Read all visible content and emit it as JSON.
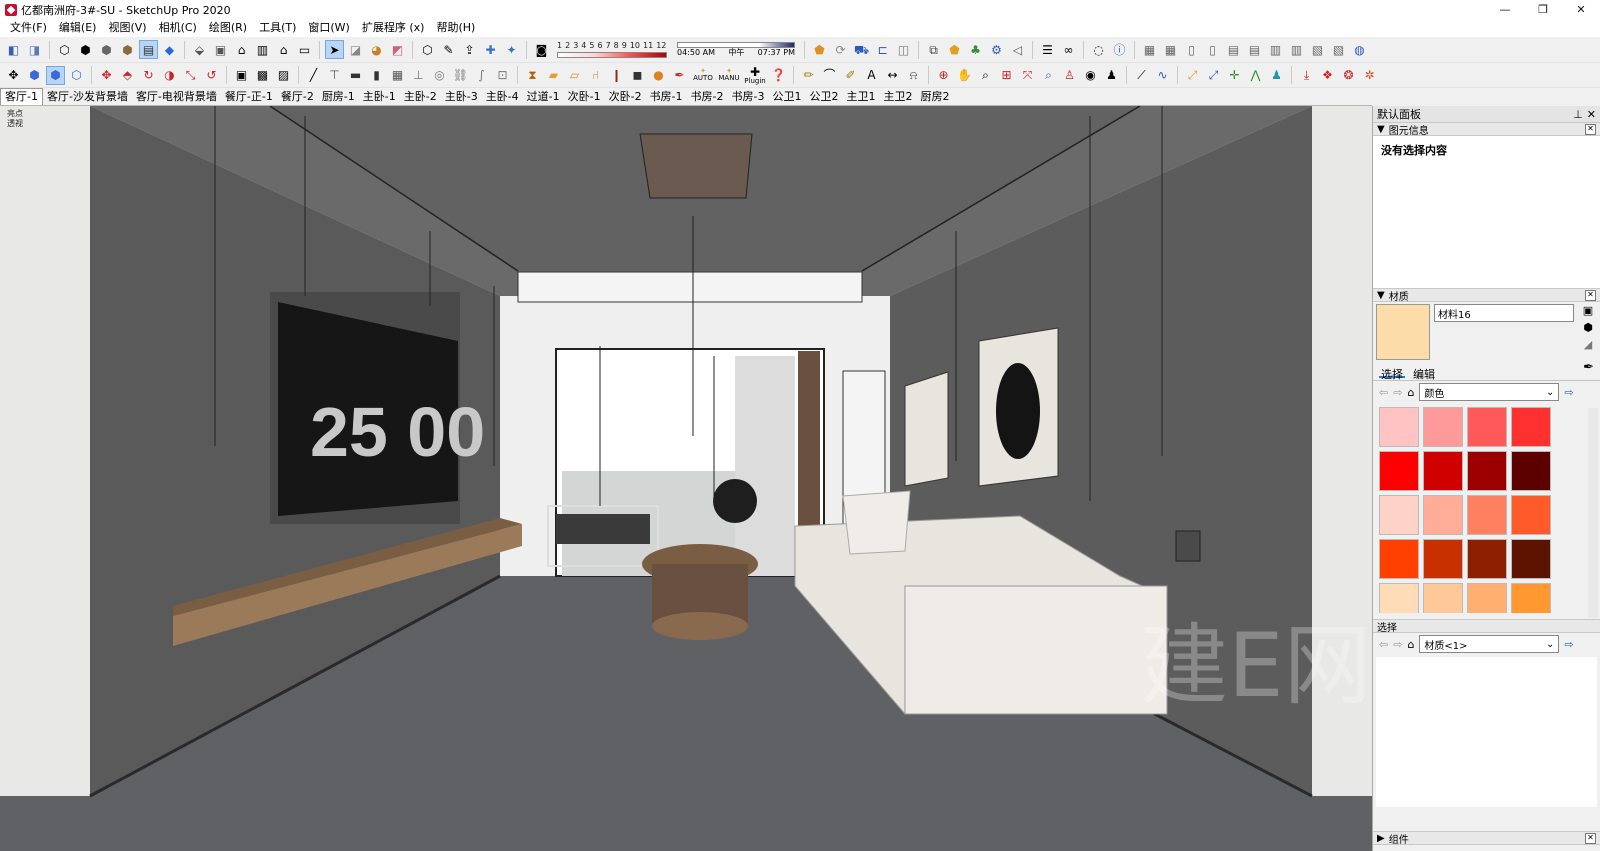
{
  "window": {
    "title": "亿都南洲府-3#-SU - SketchUp Pro 2020",
    "minimize": "—",
    "restore": "❐",
    "close": "✕"
  },
  "menu": [
    "文件(F)",
    "编辑(E)",
    "视图(V)",
    "相机(C)",
    "绘图(R)",
    "工具(T)",
    "窗口(W)",
    "扩展程序 (x)",
    "帮助(H)"
  ],
  "toolbar1": {
    "shadow_scale": [
      "1",
      "2",
      "3",
      "4",
      "5",
      "6",
      "7",
      "8",
      "9",
      "10",
      "11",
      "12"
    ],
    "time_start": "04:50 AM",
    "time_mid": "中午",
    "time_end": "07:37 PM"
  },
  "toolbar2": {
    "auto_label": "AUTO",
    "manu_label": "MANU",
    "plugin_label": "Plugin"
  },
  "scenes": [
    "客厅-1",
    "客厅-沙发背景墙",
    "客厅-电视背景墙",
    "餐厅-正-1",
    "餐厅-2",
    "厨房-1",
    "主卧-1",
    "主卧-2",
    "主卧-3",
    "主卧-4",
    "过道-1",
    "次卧-1",
    "次卧-2",
    "书房-1",
    "书房-2",
    "书房-3",
    "公卫1",
    "公卫2",
    "主卫1",
    "主卫2",
    "厨房2"
  ],
  "active_scene": "客厅-1",
  "viewport": {
    "label_line1": "亮点",
    "label_line2": "透视",
    "tv_text": "25 00"
  },
  "tray": {
    "title": "默认面板",
    "pin": "⊥",
    "close": "✕"
  },
  "entity_info": {
    "header": "图元信息",
    "empty": "没有选择内容"
  },
  "materials": {
    "header": "材质",
    "name": "材料16",
    "current_color": "#fcdca8",
    "tab_select": "选择",
    "tab_edit": "编辑",
    "collection": "颜色",
    "swatches": [
      "#ffc3c3",
      "#ff9a9a",
      "#ff5a5a",
      "#ff3030",
      "#ff0000",
      "#d00000",
      "#9c0000",
      "#5c0000",
      "#ffd2c8",
      "#ffac98",
      "#ff8060",
      "#ff5a2a",
      "#ff4000",
      "#c83000",
      "#8c2000",
      "#5c1400",
      "#ffdcb8",
      "#ffc898",
      "#ffb070",
      "#ff9830"
    ]
  },
  "select2": {
    "label": "选择",
    "dropdown": "材质<1>"
  },
  "components": {
    "header": "组件"
  },
  "colors": {
    "wall": "#5b5b5b",
    "floor": "#616265",
    "ceiling": "#6e6e6e",
    "sofa": "#e8e4de",
    "wood": "#7a5e44"
  }
}
